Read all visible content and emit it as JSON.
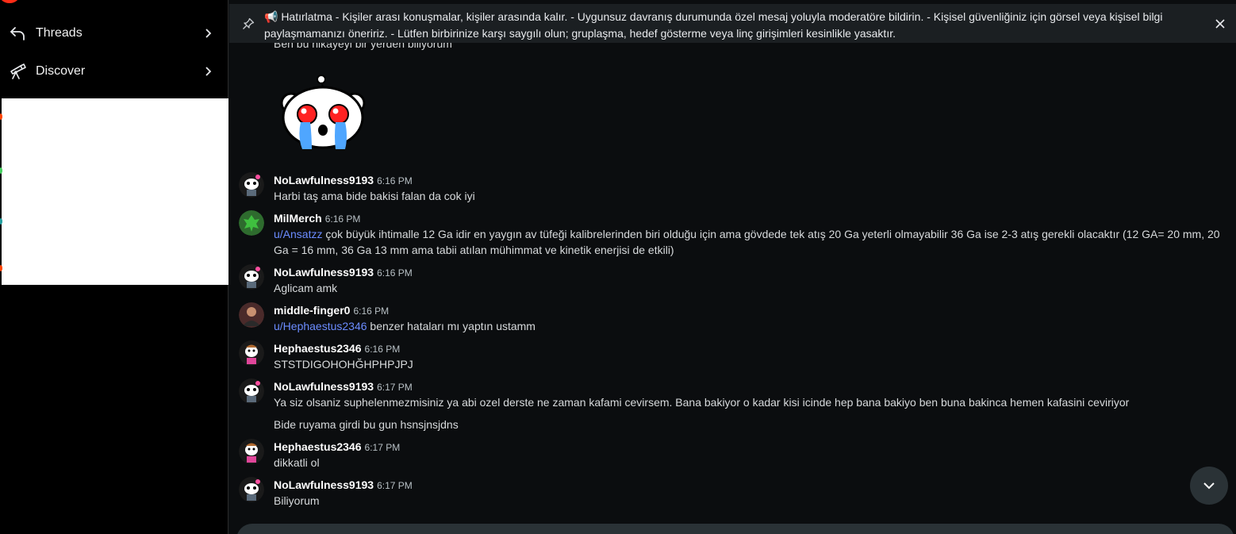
{
  "sidebar": {
    "items": [
      {
        "label": "Threads",
        "icon": "reply-arrow-icon"
      },
      {
        "label": "Discover",
        "icon": "telescope-icon"
      }
    ]
  },
  "pinned": {
    "text": "📢 Hatırlatma - Kişiler arası konuşmalar, kişiler arasında kalır. - Uygunsuz davranış durumunda özel mesaj yoluyla moderatöre bildirin. - Kişisel güvenliğiniz için görsel veya kişisel bilgi paylaşmamanızı öneririz. - Lütfen birbirinize karşı saygılı olun; gruplaşma, hedef gösterme veya linç girişimleri kesinlikle yasaktır."
  },
  "partial_message": "Ben bu hikayeyi bir yerden biliyorum",
  "messages": [
    {
      "user": "NoLawfulness9193",
      "time": "6:16 PM",
      "mention": "",
      "text": "Harbi taş ama bide bakisi falan da cok iyi"
    },
    {
      "user": "MilMerch",
      "time": "6:16 PM",
      "mention": "u/Ansatzz",
      "text": " çok büyük ihtimalle 12 Ga idir en yaygın av tüfeği kalibrelerinden biri olduğu için ama gövdede tek atış 20 Ga yeterli olmayabilir 36 Ga ise 2-3 atış gerekli olacaktır (12 GA= 20 mm, 20 Ga = 16 mm, 36 Ga 13 mm ama tabii atılan mühimmat ve kinetik enerjisi de etkili)"
    },
    {
      "user": "NoLawfulness9193",
      "time": "6:16 PM",
      "mention": "",
      "text": "Aglicam amk"
    },
    {
      "user": "middle-finger0",
      "time": "6:16 PM",
      "mention": "u/Hephaestus2346",
      "text": " benzer hataları mı yaptın ustamm"
    },
    {
      "user": "Hephaestus2346",
      "time": "6:16 PM",
      "mention": "",
      "text": "STSTDIGOHOHĞHPHPJPJ"
    },
    {
      "user": "NoLawfulness9193",
      "time": "6:17 PM",
      "mention": "",
      "text": "Ya siz olsaniz suphelenmezmisiniz ya abi ozel derste ne zaman kafami cevirsem. Bana bakiyor o kadar kisi icinde hep bana bakiyo ben buna bakinca hemen kafasini ceviriyor"
    },
    {
      "user": "Hephaestus2346",
      "time": "6:17 PM",
      "mention": "",
      "text": "dikkatli ol"
    },
    {
      "user": "NoLawfulness9193",
      "time": "6:17 PM",
      "mention": "",
      "text": "Biliyorum"
    }
  ],
  "continuation": "Bide ruyama girdi bu gun hsnsjnsjdns",
  "colors": {
    "accent": "#ff4500",
    "mention": "#6b8cff",
    "background": "#0b0d0f"
  }
}
